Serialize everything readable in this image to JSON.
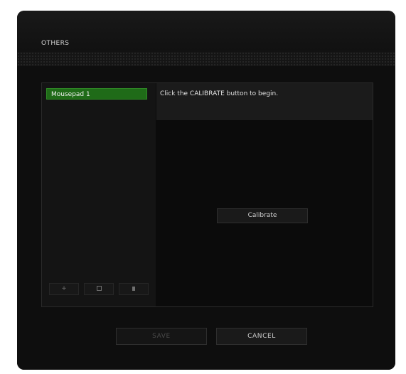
{
  "header": {
    "title": "OTHERS"
  },
  "device_list": {
    "items": [
      {
        "label": "Mousepad 1",
        "selected": true
      }
    ],
    "add_label": "+",
    "copy_icon": "copy-icon",
    "delete_icon": "trash-icon"
  },
  "calibration": {
    "instruction": "Click the CALIBRATE button to begin.",
    "calibrate_label": "Calibrate"
  },
  "footer": {
    "save_label": "SAVE",
    "cancel_label": "CANCEL"
  },
  "colors": {
    "accent_green": "#1f6b18",
    "background": "#121212"
  }
}
